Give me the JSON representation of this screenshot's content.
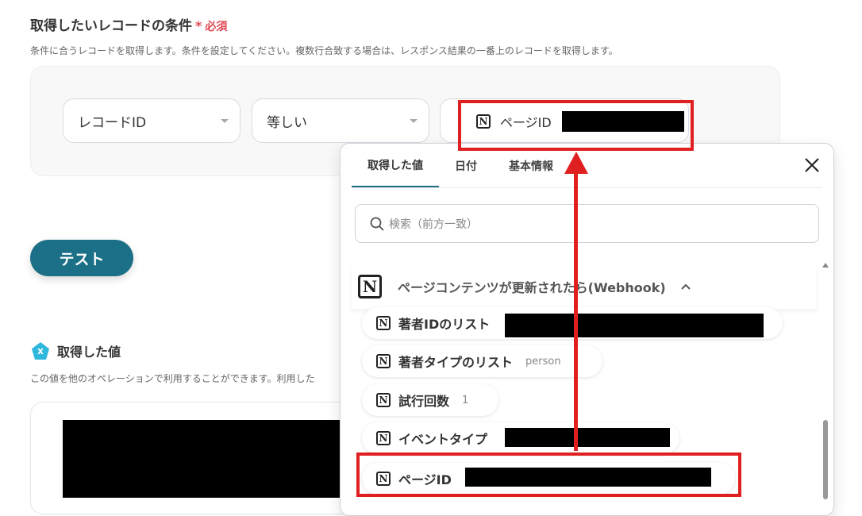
{
  "section": {
    "title": "取得したいレコードの条件",
    "required_star": "*",
    "required_label": "必須",
    "description": "条件に合うレコードを取得します。条件を設定してください。複数行合致する場合は、レスポンス結果の一番上のレコードを取得します。"
  },
  "condition": {
    "field_select": "レコードID",
    "operator_select": "等しい",
    "value_chip_label": "ページID"
  },
  "test_button": "テスト",
  "retrieved": {
    "title": "取得した値",
    "badge_glyph": "x",
    "description": "この値を他のオペレーションで利用することができます。利用した"
  },
  "popup": {
    "tabs": [
      "取得した値",
      "日付",
      "基本情報"
    ],
    "active_tab": 0,
    "search_placeholder": "検索（前方一致）",
    "group_title": "ページコンテンツが更新されたら(Webhook)",
    "items": [
      {
        "label": "著者IDのリスト",
        "value": ""
      },
      {
        "label": "著者タイプのリスト",
        "value": "person"
      },
      {
        "label": "試行回数",
        "value": "1"
      },
      {
        "label": "イベントタイプ",
        "value": ""
      },
      {
        "label": "ページID",
        "value": ""
      }
    ]
  },
  "colors": {
    "accent": "#1b6f87",
    "required": "#e04a55",
    "annotation": "#e02020",
    "badge": "#2fb8dc"
  },
  "icons": [
    "notion-icon",
    "search-icon",
    "close-icon",
    "chevron-up-icon",
    "chevron-down-icon",
    "x-badge-icon"
  ]
}
